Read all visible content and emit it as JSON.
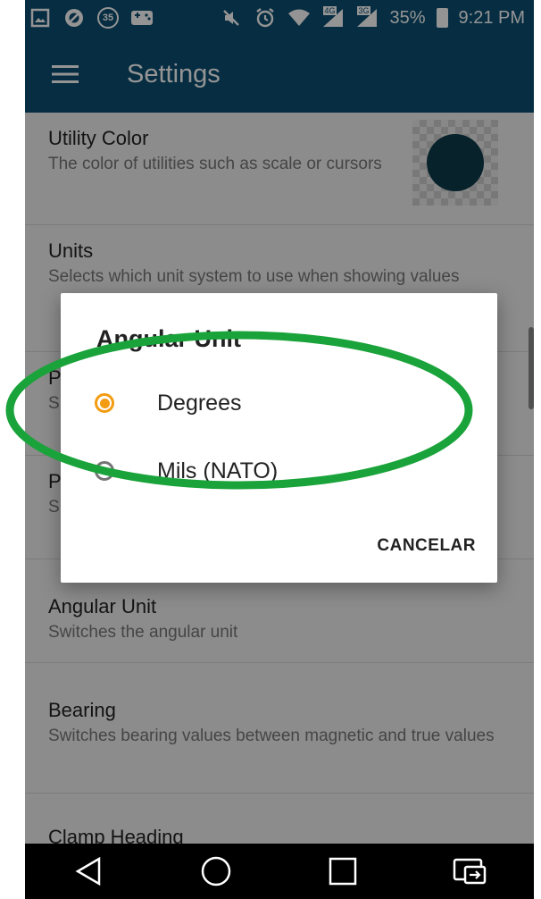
{
  "status_bar": {
    "notification_badge": "35",
    "battery_percent": "35%",
    "time": "9:21 PM",
    "network_label_1": "4G",
    "network_label_2": "3G"
  },
  "app_bar": {
    "title": "Settings"
  },
  "settings": [
    {
      "title": "Utility Color",
      "subtitle": "The color of utilities such as scale or cursors"
    },
    {
      "title": "Units",
      "subtitle": "Selects which unit system to use when showing values"
    },
    {
      "title": "P",
      "subtitle": "S"
    },
    {
      "title": "P",
      "subtitle": "S"
    },
    {
      "title": "Angular Unit",
      "subtitle": "Switches the angular unit"
    },
    {
      "title": "Bearing",
      "subtitle": "Switches bearing values between magnetic and true values"
    },
    {
      "title": "Clamp Heading",
      "subtitle": ""
    }
  ],
  "utility_color": "#0d3b4a",
  "dialog": {
    "title": "Angular Unit",
    "options": [
      {
        "label": "Degrees",
        "selected": true
      },
      {
        "label": "Mils (NATO)",
        "selected": false
      }
    ],
    "cancel_label": "CANCELAR"
  },
  "colors": {
    "app_bar": "#0b4f72",
    "accent": "#f39c12",
    "annotation": "#1aa33a"
  }
}
